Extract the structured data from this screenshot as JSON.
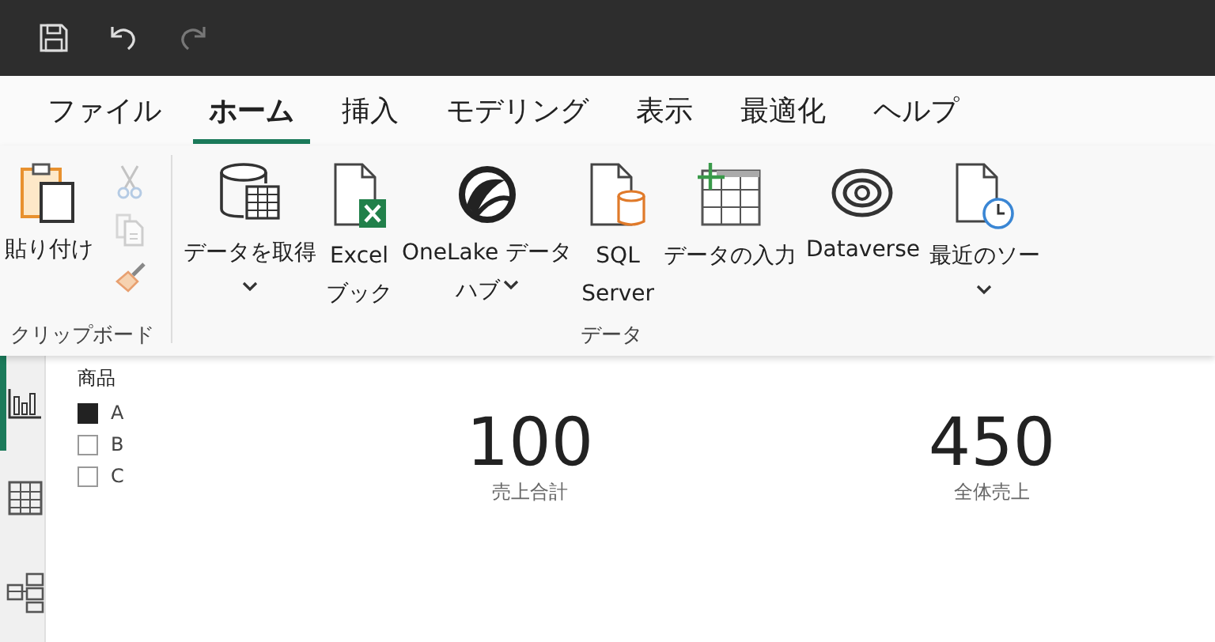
{
  "menu_tabs": [
    {
      "label": "ファイル",
      "selected": false
    },
    {
      "label": "ホーム",
      "selected": true
    },
    {
      "label": "挿入",
      "selected": false
    },
    {
      "label": "モデリング",
      "selected": false
    },
    {
      "label": "表示",
      "selected": false
    },
    {
      "label": "最適化",
      "selected": false
    },
    {
      "label": "ヘルプ",
      "selected": false
    }
  ],
  "ribbon_groups": [
    {
      "label": "クリップボード",
      "buttons": [
        {
          "kind": "paste",
          "lines": [
            "貼り付け"
          ],
          "dropdown": false
        }
      ],
      "small_tools": [
        {
          "kind": "cut",
          "disabled": true
        },
        {
          "kind": "copy",
          "disabled": true
        },
        {
          "kind": "painter",
          "disabled": false
        }
      ]
    },
    {
      "label": "データ",
      "buttons": [
        {
          "kind": "database",
          "lines": [
            "データを取得"
          ],
          "dropdown": true
        },
        {
          "kind": "excel",
          "lines": [
            "Excel",
            "ブック"
          ],
          "dropdown": false
        },
        {
          "kind": "onelake",
          "lines": [
            "OneLake データ",
            "ハブ"
          ],
          "dropdown": true
        },
        {
          "kind": "sql",
          "lines": [
            "SQL",
            "Server"
          ],
          "dropdown": false
        },
        {
          "kind": "enter",
          "lines": [
            "データの入力"
          ],
          "dropdown": false
        },
        {
          "kind": "dataverse",
          "lines": [
            "Dataverse"
          ],
          "dropdown": false
        },
        {
          "kind": "recent",
          "lines": [
            "最近のソー"
          ],
          "dropdown": true
        }
      ]
    }
  ],
  "side_nav": [
    {
      "kind": "report",
      "selected": true
    },
    {
      "kind": "table",
      "selected": false
    },
    {
      "kind": "model",
      "selected": false
    }
  ],
  "slicer": {
    "title": "商品",
    "items": [
      {
        "label": "A",
        "checked": true
      },
      {
        "label": "B",
        "checked": false
      },
      {
        "label": "C",
        "checked": false
      }
    ]
  },
  "cards": [
    {
      "value": "100",
      "label": "売上合計"
    },
    {
      "value": "450",
      "label": "全体売上"
    }
  ]
}
